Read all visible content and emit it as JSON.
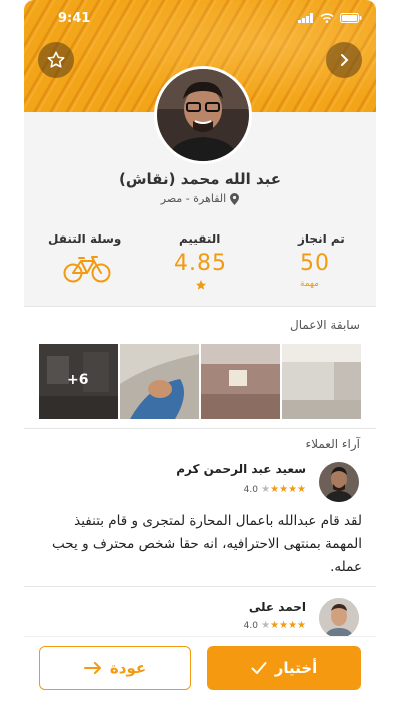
{
  "status_bar": {
    "time": "9:41"
  },
  "profile": {
    "name": "عبد الله محمد (نقاش)",
    "location": "القاهرة - مصر"
  },
  "stats": {
    "completed": {
      "label": "تم انجاز",
      "value": "50",
      "unit": "مهمة"
    },
    "rating": {
      "label": "التقييم",
      "value": "4.85"
    },
    "transport": {
      "label": "وسلة التنقل",
      "icon": "bicycle-icon"
    }
  },
  "portfolio": {
    "title": "سابقة الاعمال",
    "more_count": "+6"
  },
  "reviews": {
    "title": "آراء العملاء",
    "items": [
      {
        "name": "سعيد عبد الرحمن كرم",
        "rating": "4.0",
        "stars_filled": 4,
        "text": "لقد قام عبدالله باعمال المحارة لمتجرى و قام بتنفيذ المهمة بمنتهى الاحترافيه، انه حقا شخص محترف و يحب عمله."
      },
      {
        "name": "احمد على",
        "rating": "4.0",
        "stars_filled": 4
      }
    ]
  },
  "actions": {
    "choose_label": "أختيار",
    "back_label": "عودة"
  },
  "colors": {
    "accent": "#f59a10",
    "background": "#f4f4f4"
  }
}
